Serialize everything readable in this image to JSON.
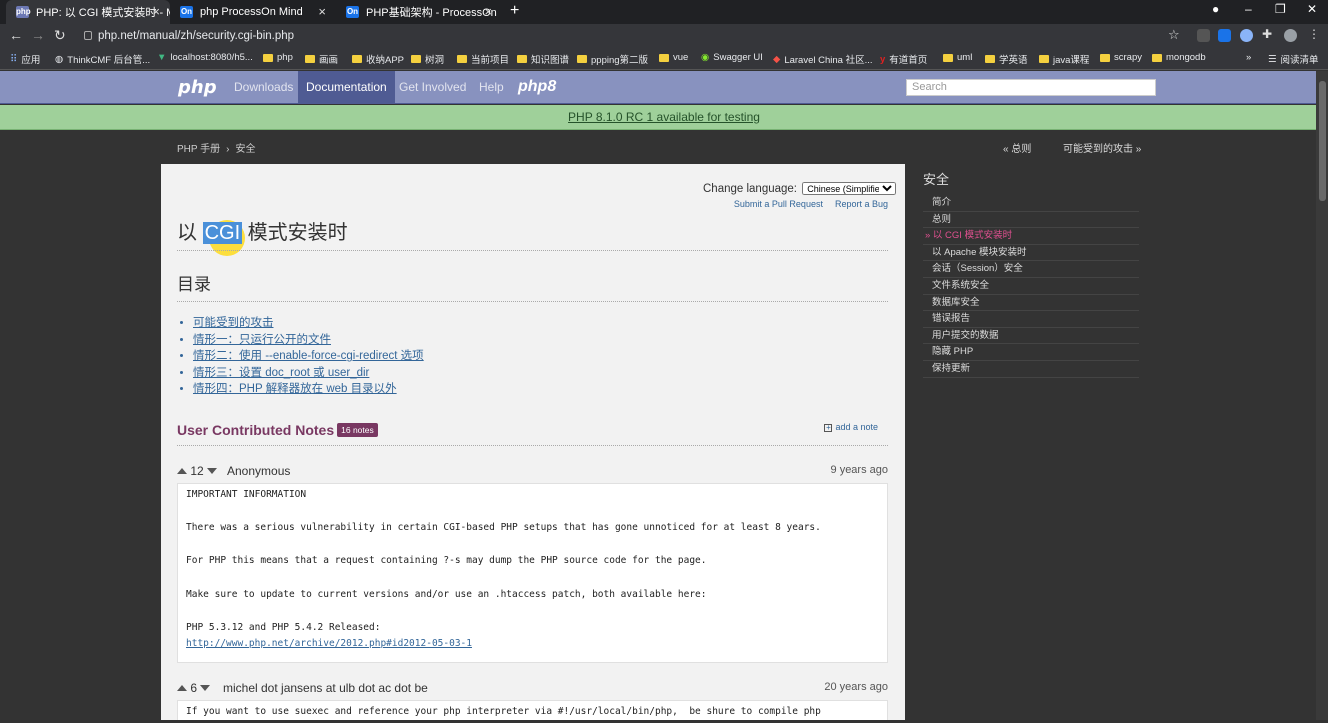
{
  "browser": {
    "tabs": [
      {
        "title": "PHP: 以 CGI 模式安装时 - Manu",
        "favicon": "php",
        "active": true
      },
      {
        "title": "php ProcessOn Mind",
        "favicon": "On",
        "active": false
      },
      {
        "title": "PHP基础架构 - ProcessOn",
        "favicon": "On",
        "active": false
      }
    ],
    "url": "php.net/manual/zh/security.cgi-bin.php",
    "bookmarks": [
      "应用",
      "ThinkCMF 后台管...",
      "localhost:8080/h5...",
      "php",
      "画画",
      "收纳APP",
      "树洞",
      "当前项目",
      "知识图谱",
      "ppping第二版",
      "vue",
      "Swagger UI",
      "Laravel China 社区...",
      "有道首页",
      "uml",
      "学英语",
      "java课程",
      "scrapy",
      "mongodb",
      "阅读清单"
    ]
  },
  "phpnav": {
    "logo": "php",
    "items": [
      "Downloads",
      "Documentation",
      "Get Involved",
      "Help"
    ],
    "php8": "php8",
    "search_placeholder": "Search"
  },
  "announcement": "PHP 8.1.0 RC 1 available for testing",
  "breadcrumb": {
    "home": "PHP 手册",
    "sep": "›",
    "current": "安全"
  },
  "prevnext": {
    "prev": "« 总则",
    "next": "可能受到的攻击 »"
  },
  "content": {
    "change_language_label": "Change language:",
    "language": "Chinese (Simplified)",
    "submit_pr": "Submit a Pull Request",
    "report_bug": "Report a Bug",
    "title_pre": "以 ",
    "title_hl": "CGI",
    "title_post": " 模式安装时",
    "toc_heading": "目录",
    "toc": [
      "可能受到的攻击",
      "情形一：只运行公开的文件",
      "情形二：使用 --enable-force-cgi-redirect 选项",
      "情形三：设置 doc_root 或 user_dir",
      "情形四：PHP 解释器放在 web 目录以外"
    ],
    "ucn_title": "User Contributed Notes",
    "ucn_badge": "16 notes",
    "add_note": "add a note"
  },
  "notes": [
    {
      "votes": "12",
      "author": "Anonymous",
      "date": "9 years ago",
      "lines": [
        "IMPORTANT INFORMATION",
        "",
        "There was a serious vulnerability in certain CGI-based PHP setups that has gone unnoticed for at least 8 years.",
        "",
        "For PHP this means that a request containing ?-s may dump the PHP source code for the page.",
        "",
        "Make sure to update to current versions and/or use an .htaccess patch, both available here:",
        "",
        "PHP 5.3.12 and PHP 5.4.2 Released:"
      ],
      "link": "http://www.php.net/archive/2012.php#id2012-05-03-1"
    },
    {
      "votes": "6",
      "author": "michel dot jansens at ulb dot ac dot be",
      "date": "20 years ago",
      "lines": [
        "If you want to use suexec and reference your php interpreter via #!/usr/local/bin/php,  be shure to compile php"
      ]
    }
  ],
  "sidebar": {
    "heading": "安全",
    "items": [
      {
        "label": "简介",
        "current": false
      },
      {
        "label": "总则",
        "current": false
      },
      {
        "label": "» 以 CGI 模式安装时",
        "current": true
      },
      {
        "label": "以 Apache 模块安装时",
        "current": false
      },
      {
        "label": "会话（Session）安全",
        "current": false
      },
      {
        "label": "文件系统安全",
        "current": false
      },
      {
        "label": "数据库安全",
        "current": false
      },
      {
        "label": "错误报告",
        "current": false
      },
      {
        "label": "用户提交的数据",
        "current": false
      },
      {
        "label": "隐藏 PHP",
        "current": false
      },
      {
        "label": "保持更新",
        "current": false
      }
    ]
  },
  "colors": {
    "nav": "#8892bf",
    "nav_active": "#4f5b93",
    "announce": "#9fd09a",
    "accent": "#793862",
    "link": "#336699"
  }
}
